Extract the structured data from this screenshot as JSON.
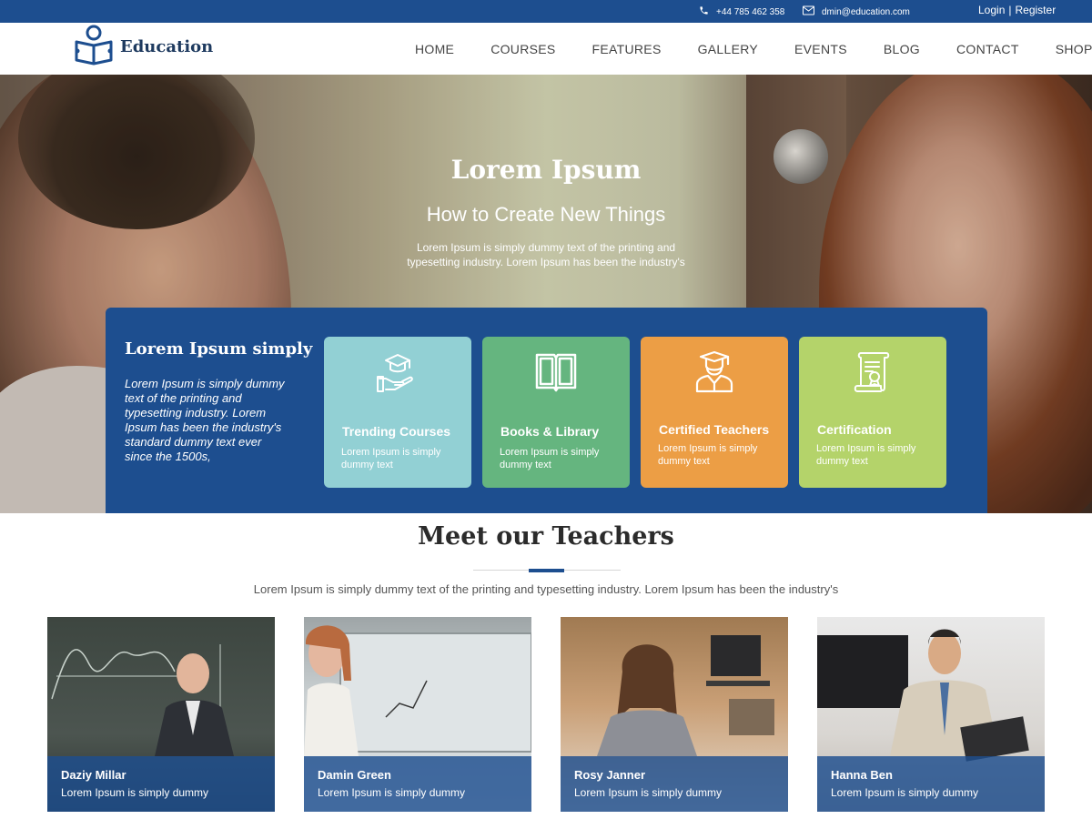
{
  "topbar": {
    "phone": "+44 785 462 358",
    "email": "dmin@education.com",
    "login": "Login",
    "separator": "|",
    "register": "Register"
  },
  "header": {
    "logo_text": "Education",
    "nav": [
      "HOME",
      "COURSES",
      "FEATURES",
      "GALLERY",
      "EVENTS",
      "BLOG",
      "CONTACT",
      "SHOP"
    ]
  },
  "hero": {
    "title": "Lorem Ipsum",
    "subtitle": "How to Create New Things",
    "text": "Lorem Ipsum is simply dummy text of the printing and typesetting industry. Lorem Ipsum has been the industry's"
  },
  "panel": {
    "title": "Lorem Ipsum simply",
    "text": "Lorem Ipsum is simply dummy text of the printing and typesetting industry. Lorem Ipsum has been the industry's standard dummy text ever since the 1500s,",
    "cards": [
      {
        "title": "Trending Courses",
        "text": "Lorem Ipsum is simply dummy text",
        "icon": "graduation-cap-hand-icon",
        "color": "#92d0d4"
      },
      {
        "title": "Books & Library",
        "text": "Lorem Ipsum is simply dummy text",
        "icon": "open-book-icon",
        "color": "#65b57f"
      },
      {
        "title": "Certified Teachers",
        "text": "Lorem Ipsum is simply dummy text",
        "icon": "teacher-icon",
        "color": "#ec9e45"
      },
      {
        "title": "Certification",
        "text": "Lorem Ipsum is simply dummy text",
        "icon": "certificate-icon",
        "color": "#b4d36a"
      }
    ]
  },
  "teachers": {
    "title": "Meet our Teachers",
    "description": "Lorem Ipsum is simply dummy text of the printing and typesetting industry. Lorem Ipsum has been the industry's",
    "items": [
      {
        "name": "Daziy Millar",
        "text": "Lorem Ipsum is simply dummy"
      },
      {
        "name": "Damin Green",
        "text": "Lorem Ipsum is simply dummy"
      },
      {
        "name": "Rosy Janner",
        "text": "Lorem Ipsum is simply dummy"
      },
      {
        "name": "Hanna Ben",
        "text": "Lorem Ipsum is simply dummy"
      }
    ]
  },
  "colors": {
    "primary": "#1d4e8f",
    "card_teal": "#92d0d4",
    "card_green": "#65b57f",
    "card_orange": "#ec9e45",
    "card_lime": "#b4d36a"
  }
}
